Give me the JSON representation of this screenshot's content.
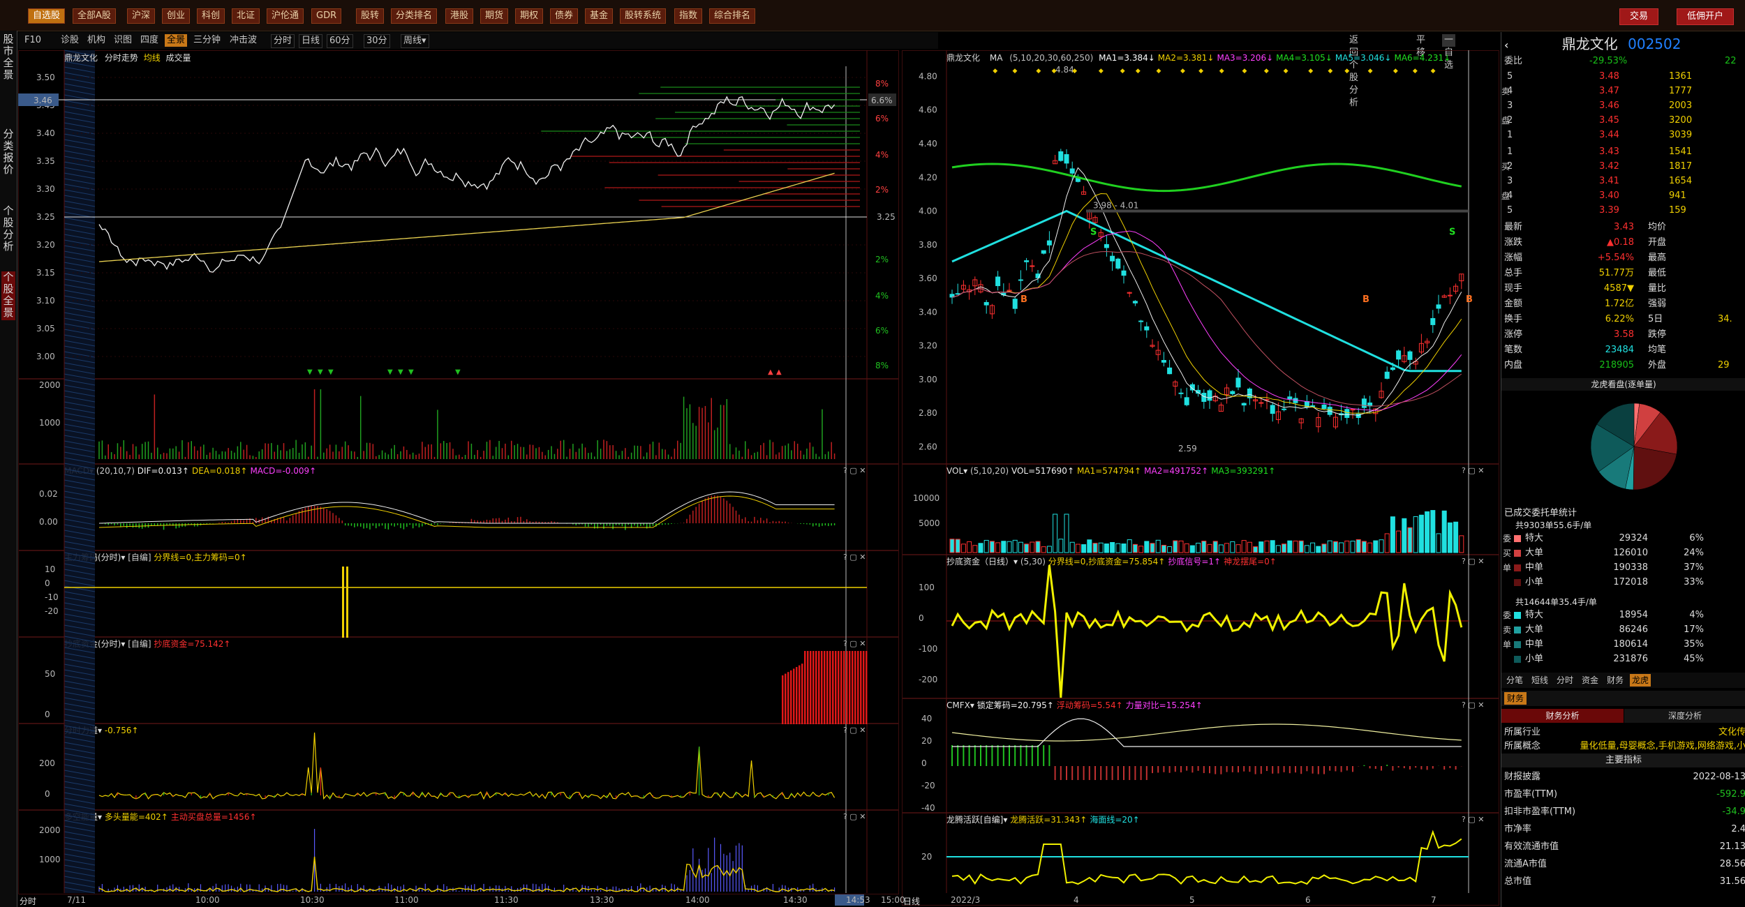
{
  "top_menu": [
    "自选股",
    "全部A股",
    "沪深",
    "创业",
    "科创",
    "北证",
    "沪伦通",
    "GDR",
    "股转",
    "分类排名",
    "港股",
    "期货",
    "期权",
    "债券",
    "基金",
    "股转系统",
    "指数",
    "综合排名"
  ],
  "top_right_buttons": [
    "交易",
    "低佣开户"
  ],
  "left_nav": [
    {
      "label": "股市全景"
    },
    {
      "label": "分类报价"
    },
    {
      "label": "个股分析"
    },
    {
      "label": "个股全景"
    }
  ],
  "toolbar": {
    "items": [
      "F10",
      "诊股",
      "机构",
      "识图",
      "四度",
      "全景",
      "三分钟",
      "冲击波"
    ],
    "periods": [
      "分时",
      "日线",
      "60分",
      "30分",
      "周线▾"
    ],
    "selected": "全景",
    "right": [
      "返回个股分析",
      "平移",
      "一自选"
    ]
  },
  "intraday": {
    "title": "鼎龙文化",
    "subtitle": "分时走势",
    "avg_label": "均线",
    "vol_label": "成交量",
    "price_ticks": [
      "3.50",
      "3.45",
      "3.40",
      "3.35",
      "3.30",
      "3.25",
      "3.20",
      "3.15",
      "3.10",
      "3.05",
      "3.00"
    ],
    "pct_ticks": [
      "8%",
      "6%",
      "4%",
      "2%",
      "2%",
      "4%",
      "6%",
      "8%"
    ],
    "mid_price": "3.25",
    "cur_price": "3.46",
    "cur_pct": "6.6%",
    "vol_ticks": [
      "2000",
      "1000"
    ],
    "time_labels": [
      "7/11",
      "10:00",
      "10:30",
      "11:00",
      "11:30",
      "13:30",
      "14:00",
      "14:30",
      "14:53",
      "15:00"
    ],
    "bottom_left": "分时"
  },
  "daily": {
    "title": "鼎龙文化",
    "ma_label": "MA",
    "ma_periods": "(5,10,20,30,60,250)",
    "ma_values": [
      {
        "t": "MA1=3.384",
        "c": "#ffffff"
      },
      {
        "t": "MA2=3.381",
        "c": "#f0d000"
      },
      {
        "t": "MA3=3.206",
        "c": "#ff40ff"
      },
      {
        "t": "MA4=3.105",
        "c": "#20e020"
      },
      {
        "t": "MA5=3.046",
        "c": "#20e0e0"
      },
      {
        "t": "MA6=4.231",
        "c": "#20e020"
      }
    ],
    "price_ticks": [
      "4.80",
      "4.60",
      "4.40",
      "4.20",
      "4.00",
      "3.80",
      "3.60",
      "3.40",
      "3.20",
      "3.00",
      "2.80",
      "2.60"
    ],
    "hi_label": "4.84",
    "lo_label": "2.59",
    "range_label": "3.98 - 4.01",
    "date_labels": [
      "2022/3",
      "4",
      "5",
      "6",
      "7"
    ],
    "bottom_left": "日线"
  },
  "indicators_left": [
    {
      "name": "MACD",
      "params": "(20,10,7)",
      "vals": [
        {
          "t": "DIF=0.013",
          "c": "#f0f0f0"
        },
        {
          "t": "DEA=0.018",
          "c": "#f0d000"
        },
        {
          "t": "MACD=-0.009",
          "c": "#ff40ff"
        }
      ],
      "ticks": [
        "0.02",
        "0.00"
      ]
    },
    {
      "name": "主力筹码(分时)",
      "params": "[自编]",
      "vals": [
        {
          "t": "分界线=0,主力筹码=0",
          "c": "#f0d000"
        }
      ],
      "ticks": [
        "10",
        "0",
        "-10",
        "-20"
      ]
    },
    {
      "name": "抄底资金(分时)",
      "params": "[自编]",
      "vals": [
        {
          "t": "抄底资金=75.142",
          "c": "#ff3030"
        }
      ],
      "ticks": [
        "50",
        "0"
      ]
    },
    {
      "name": "分时力道",
      "params": "",
      "vals": [
        {
          "t": "-0.756",
          "c": "#f0d000"
        }
      ],
      "ticks": [
        "200",
        "0"
      ]
    },
    {
      "name": "多空能量",
      "params": "",
      "vals": [
        {
          "t": "多头量能=402",
          "c": "#f0d000"
        },
        {
          "t": "主动买盘总量=1456",
          "c": "#ff3030"
        }
      ],
      "ticks": [
        "2000",
        "1000"
      ]
    }
  ],
  "indicators_right": [
    {
      "name": "VOL",
      "params": "(5,10,20)",
      "vals": [
        {
          "t": "VOL=517690",
          "c": "#f0f0f0"
        },
        {
          "t": "MA1=574794",
          "c": "#f0d000"
        },
        {
          "t": "MA2=491752",
          "c": "#ff40ff"
        },
        {
          "t": "MA3=393291",
          "c": "#20e020"
        }
      ],
      "ticks": [
        "10000",
        "5000"
      ]
    },
    {
      "name": "抄底资金（日线）",
      "params": "(5,30)",
      "vals": [
        {
          "t": "分界线=0,抄底资金=75.854",
          "c": "#f0d000"
        },
        {
          "t": "抄底信号=1",
          "c": "#ff40ff"
        },
        {
          "t": "神龙摆尾=0",
          "c": "#ff3030"
        }
      ],
      "ticks": [
        "100",
        "0",
        "-100",
        "-200"
      ]
    },
    {
      "name": "CMFX",
      "params": "",
      "vals": [
        {
          "t": "锁定筹码=20.795",
          "c": "#f0f0f0"
        },
        {
          "t": "浮动筹码=5.54",
          "c": "#ff3030"
        },
        {
          "t": "力量对比=15.254",
          "c": "#ff40ff"
        }
      ],
      "ticks": [
        "40",
        "20",
        "0",
        "-20",
        "-40"
      ]
    },
    {
      "name": "龙腾活跃[自编]",
      "params": "",
      "vals": [
        {
          "t": "龙腾活跃=31.343",
          "c": "#f0d000"
        },
        {
          "t": "海面线=20",
          "c": "#20e0e0"
        }
      ],
      "ticks": [
        "20"
      ]
    }
  ],
  "quote": {
    "name": "鼎龙文化",
    "code": "002502",
    "weibi_label": "委比",
    "weibi": "-29.53%",
    "weicha": "22",
    "asks": [
      {
        "lv": "5",
        "p": "3.48",
        "v": "1361"
      },
      {
        "lv": "4",
        "p": "3.47",
        "v": "1777"
      },
      {
        "lv": "3",
        "p": "3.46",
        "v": "2003"
      },
      {
        "lv": "2",
        "p": "3.45",
        "v": "3200"
      },
      {
        "lv": "1",
        "p": "3.44",
        "v": "3039"
      }
    ],
    "bids": [
      {
        "lv": "1",
        "p": "3.43",
        "v": "1541"
      },
      {
        "lv": "2",
        "p": "3.42",
        "v": "1817"
      },
      {
        "lv": "3",
        "p": "3.41",
        "v": "1654"
      },
      {
        "lv": "4",
        "p": "3.40",
        "v": "941"
      },
      {
        "lv": "5",
        "p": "3.39",
        "v": "159"
      }
    ],
    "side_sell": "卖",
    "side_buy": "买",
    "side_pan": "盘",
    "stats": [
      {
        "l": "最新",
        "v": "3.43",
        "c": "red",
        "l2": "均价",
        "v2": ""
      },
      {
        "l": "涨跌",
        "v": "▲0.18",
        "c": "red",
        "l2": "开盘",
        "v2": ""
      },
      {
        "l": "涨幅",
        "v": "+5.54%",
        "c": "red",
        "l2": "最高",
        "v2": ""
      },
      {
        "l": "总手",
        "v": "51.77万",
        "c": "yel",
        "l2": "最低",
        "v2": ""
      },
      {
        "l": "现手",
        "v": "4587▼",
        "c": "yel",
        "l2": "量比",
        "v2": ""
      },
      {
        "l": "金额",
        "v": "1.72亿",
        "c": "yel",
        "l2": "强弱",
        "v2": ""
      },
      {
        "l": "换手",
        "v": "6.22%",
        "c": "yel",
        "l2": "5日",
        "v2": "34."
      },
      {
        "l": "涨停",
        "v": "3.58",
        "c": "red",
        "l2": "跌停",
        "v2": ""
      },
      {
        "l": "笔数",
        "v": "23484",
        "c": "cyan",
        "l2": "均笔",
        "v2": ""
      },
      {
        "l": "内盘",
        "v": "218905",
        "c": "grn",
        "l2": "外盘",
        "v2": "29"
      }
    ],
    "pie_title": "龙虎看盘(逐单量)",
    "order_title": "已成交委托单统计",
    "buy_summary": "共9303单55.6手/单",
    "buy_rows": [
      {
        "n": "特大",
        "v": "29324",
        "p": "6%"
      },
      {
        "n": "大单",
        "v": "126010",
        "p": "24%"
      },
      {
        "n": "中单",
        "v": "190338",
        "p": "37%"
      },
      {
        "n": "小单",
        "v": "172018",
        "p": "33%"
      }
    ],
    "sell_summary": "共14644单35.4手/单",
    "sell_rows": [
      {
        "n": "特大",
        "v": "18954",
        "p": "4%"
      },
      {
        "n": "大单",
        "v": "86246",
        "p": "17%"
      },
      {
        "n": "中单",
        "v": "180614",
        "p": "35%"
      },
      {
        "n": "小单",
        "v": "231876",
        "p": "45%"
      }
    ],
    "side_wei": "委",
    "side_mai": "买",
    "side_dan": "单",
    "tabs": [
      "分笔",
      "短线",
      "分时",
      "资金",
      "财务",
      "龙虎"
    ],
    "tab_sel": "龙虎",
    "fin_tab": "财务",
    "fin_sub": [
      "财务分析",
      "深度分析"
    ],
    "fin_rows": [
      {
        "l": "所属行业",
        "v": "文化传"
      },
      {
        "l": "所属概念",
        "v": "量化低量,母婴概念,手机游戏,网络游戏,小"
      }
    ],
    "main_idx": "主要指标",
    "idx_rows": [
      {
        "l": "财报披露",
        "v": "2022-08-13"
      },
      {
        "l": "市盈率(TTM)",
        "v": "-592.9"
      },
      {
        "l": "扣非市盈率(TTM)",
        "v": "-34.9"
      },
      {
        "l": "市净率",
        "v": "2.4"
      },
      {
        "l": "有效流通市值",
        "v": "21.13"
      },
      {
        "l": "流通A市值",
        "v": "28.56"
      },
      {
        "l": "总市值",
        "v": "31.56"
      }
    ]
  },
  "colors": {
    "up": "#ff3030",
    "down": "#20e0e0",
    "frame": "#5a1010"
  }
}
